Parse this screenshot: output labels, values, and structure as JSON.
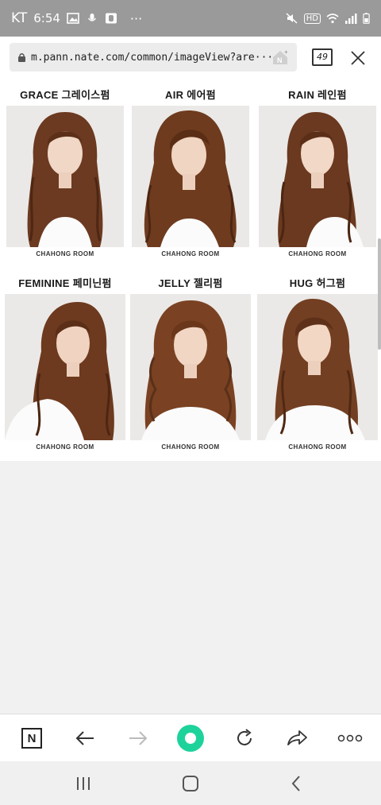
{
  "status": {
    "carrier": "KT",
    "time": "6:54",
    "more": "···",
    "hd": "HD"
  },
  "browser": {
    "url": "m.pann.nate.com/common/imageView?are···",
    "tab_count": "49"
  },
  "gallery": {
    "items": [
      {
        "label": "GRACE 그레이스펌",
        "credit": "CHAHONG ROOM"
      },
      {
        "label": "AIR 에어펌",
        "credit": "CHAHONG ROOM"
      },
      {
        "label": "RAIN 레인펌",
        "credit": "CHAHONG ROOM"
      },
      {
        "label": "FEMININE 페미닌펌",
        "credit": "CHAHONG ROOM"
      },
      {
        "label": "JELLY 젤리펌",
        "credit": "CHAHONG ROOM"
      },
      {
        "label": "HUG 허그펌",
        "credit": "CHAHONG ROOM"
      }
    ]
  },
  "bottom_nav": {
    "n_label": "N"
  },
  "colors": {
    "status_bg": "#9a9a9a",
    "accent_green": "#1ed39b",
    "hair_brown": "#6b3a20"
  }
}
